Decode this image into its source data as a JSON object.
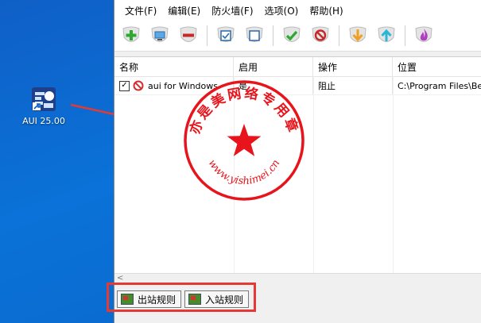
{
  "desktop": {
    "icon_label": "AUI 25.00"
  },
  "menu": [
    "文件(F)",
    "编辑(E)",
    "防火墙(F)",
    "选项(O)",
    "帮助(H)"
  ],
  "toolbar": [
    "add-icon",
    "monitor-icon",
    "remove-icon",
    "check-box-icon",
    "uncheck-box-icon",
    "allow-icon",
    "block-icon",
    "move-down-icon",
    "move-up-icon",
    "flame-icon"
  ],
  "table": {
    "headers": [
      "名称",
      "启用",
      "操作",
      "位置"
    ],
    "rows": [
      {
        "checked": "✓",
        "name": "aui for Windows",
        "enabled": "是",
        "action": "阻止",
        "location": "C:\\Program Files\\Bent"
      }
    ]
  },
  "scroll_left": "<",
  "tabs": {
    "outbound": "出站规则",
    "inbound": "入站规则"
  },
  "stamp": {
    "arc_text": "亦是美网络专用章",
    "url_text": "www.yishimei.cn"
  },
  "colors": {
    "stamp_red": "#e8141b",
    "highlight_red": "#e53935"
  }
}
